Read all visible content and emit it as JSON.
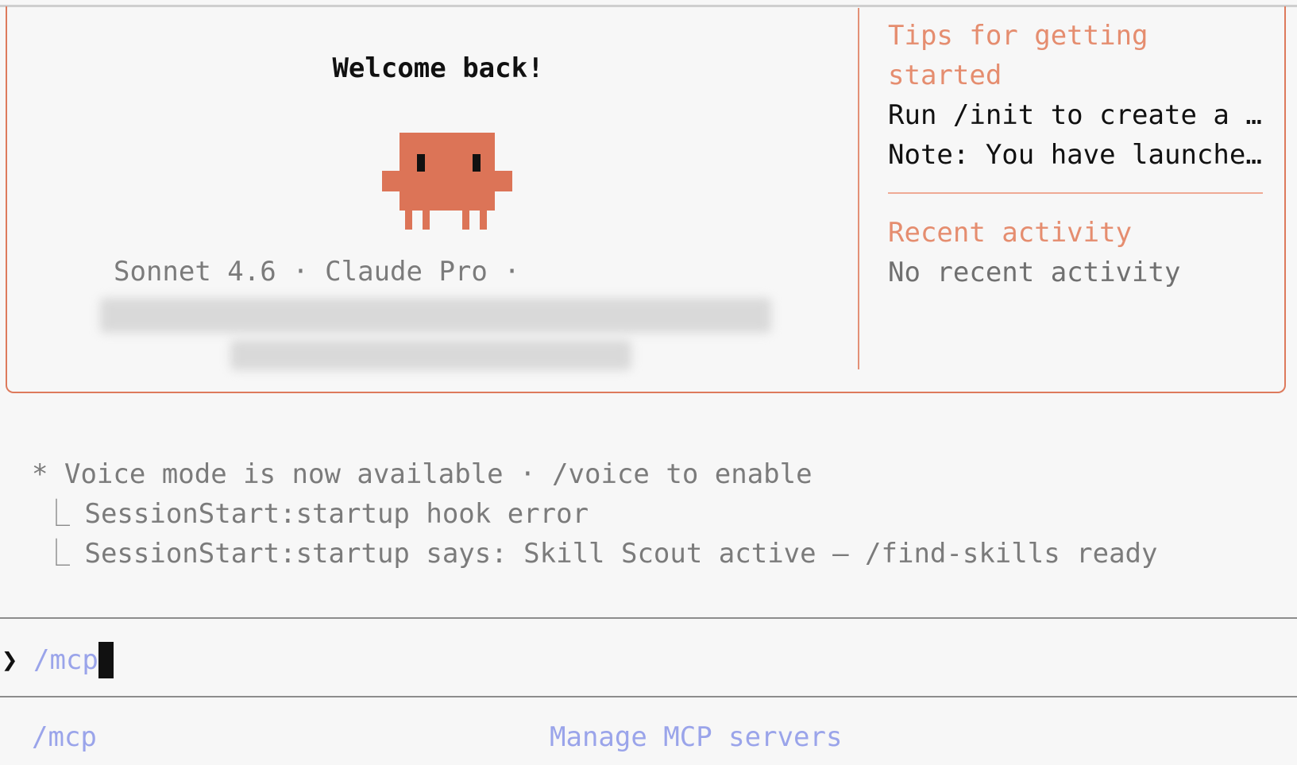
{
  "welcome": {
    "title": "Welcome back!",
    "model": "Sonnet 4.6",
    "separator": "·",
    "plan": "Claude Pro",
    "trailing_separator": "·"
  },
  "tips": {
    "heading_line1": "Tips for getting",
    "heading_line2": "started",
    "items": [
      "Run /init to create a …",
      "Note: You have launche…"
    ]
  },
  "recent_activity": {
    "heading": "Recent activity",
    "empty_text": "No recent activity"
  },
  "messages": {
    "voice": {
      "bullet": "*",
      "text": "Voice mode is now available · /voice to enable"
    },
    "hooks": [
      {
        "elbow": "⎿",
        "text": "SessionStart:startup hook error"
      },
      {
        "elbow": "⎿",
        "text": "SessionStart:startup says: Skill Scout active — /find-skills ready"
      }
    ]
  },
  "prompt": {
    "symbol": "❯",
    "value": "/mcp"
  },
  "suggestions": [
    {
      "command": "/mcp",
      "description": "Manage MCP servers"
    }
  ],
  "colors": {
    "accent": "#dd7a5c",
    "mascot": "#dc7457",
    "command": "#9aa4ea",
    "muted_text": "#7b7b7b"
  },
  "icons": {
    "mascot": "pixel-mascot-icon",
    "prompt": "chevron-right-icon",
    "elbow": "elbow-connector-icon"
  }
}
